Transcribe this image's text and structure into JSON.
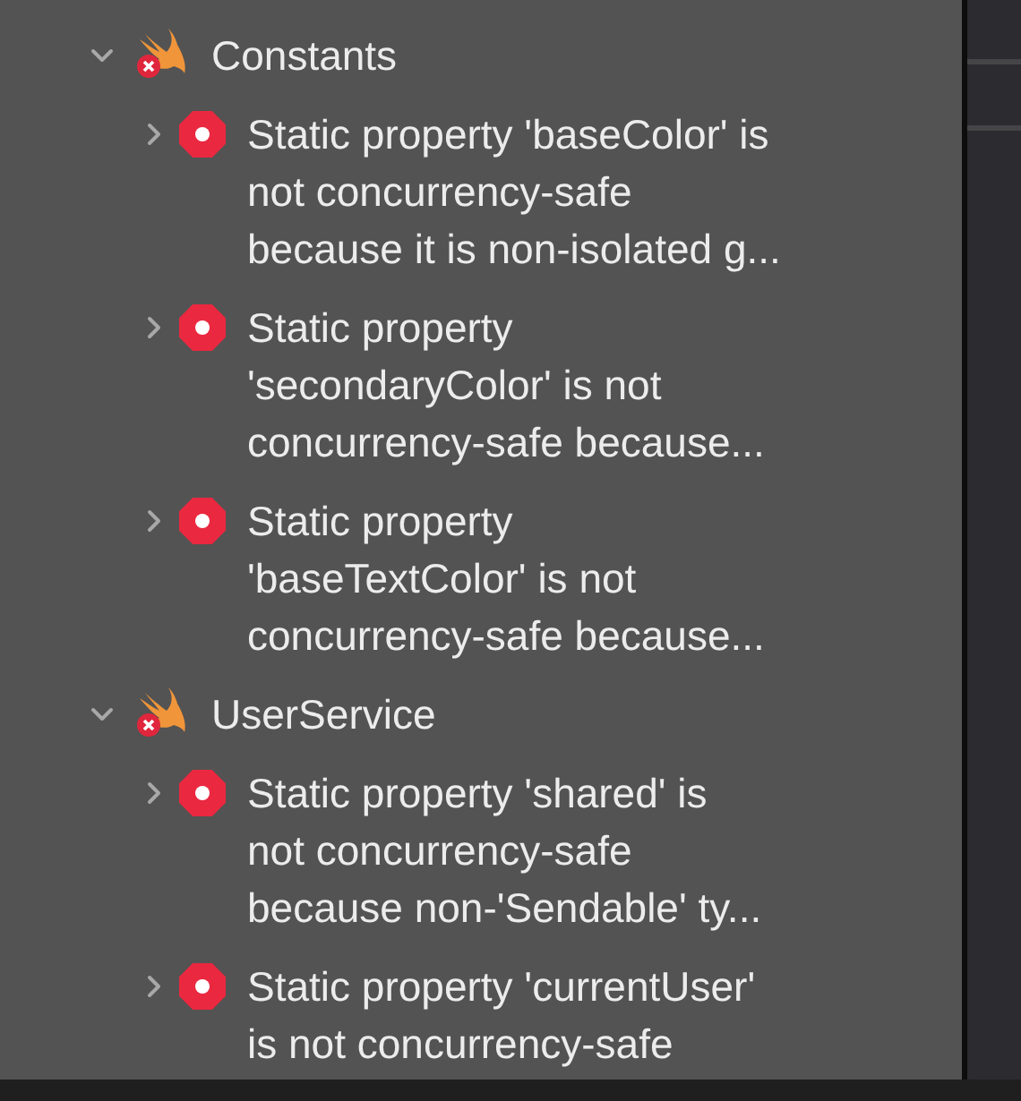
{
  "groups": [
    {
      "name": "Constants",
      "expanded": true,
      "issues": [
        {
          "expanded": false,
          "lines": [
            "Static property 'baseColor' is",
            "not concurrency-safe",
            "because it is non-isolated g..."
          ]
        },
        {
          "expanded": false,
          "lines": [
            "Static property",
            "'secondaryColor' is not",
            "concurrency-safe because..."
          ]
        },
        {
          "expanded": false,
          "lines": [
            "Static property",
            "'baseTextColor' is not",
            "concurrency-safe because..."
          ]
        }
      ]
    },
    {
      "name": "UserService",
      "expanded": true,
      "issues": [
        {
          "expanded": false,
          "lines": [
            "Static property 'shared' is",
            "not concurrency-safe",
            "because non-'Sendable' ty..."
          ]
        },
        {
          "expanded": false,
          "lines": [
            "Static property 'currentUser'",
            "is not concurrency-safe"
          ]
        }
      ]
    }
  ]
}
